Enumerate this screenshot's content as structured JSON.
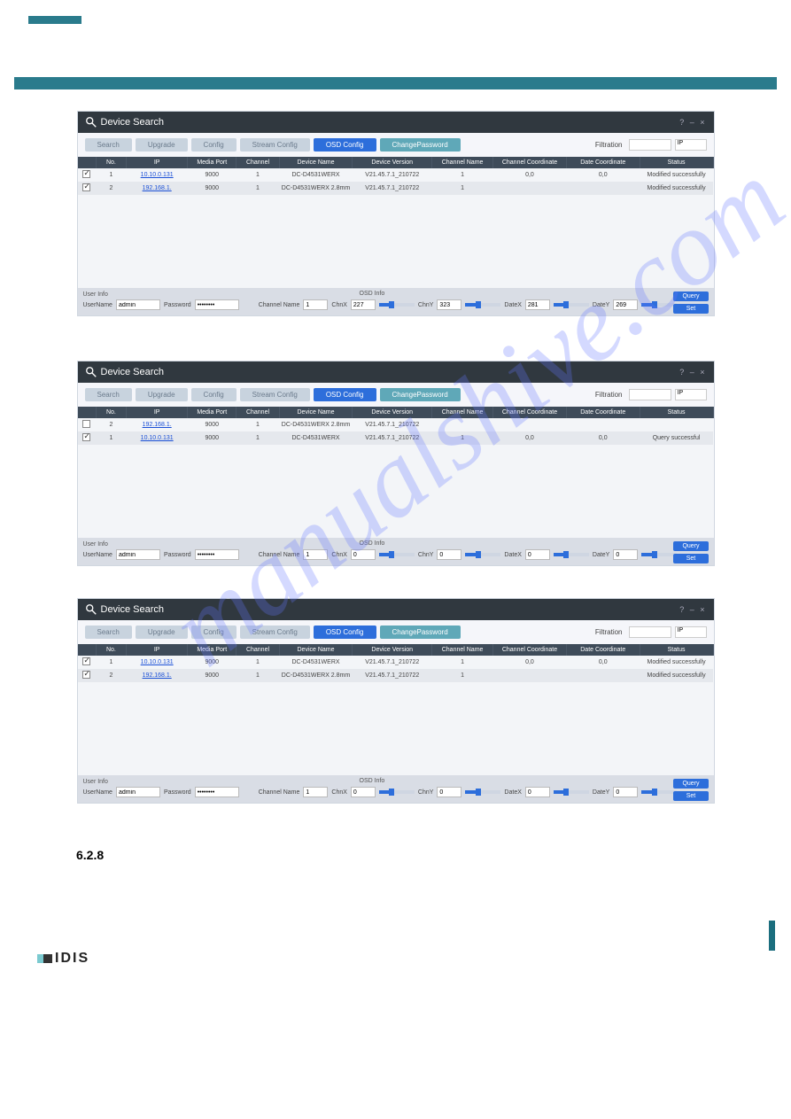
{
  "header_chip": "",
  "app": {
    "title": "Device Search",
    "window_controls": "?  –  ×"
  },
  "toolbar": {
    "search": "Search",
    "upgrade": "Upgrade",
    "config": "Config",
    "stream": "Stream Config",
    "osd": "OSD Config",
    "changepwd": "ChangePassword",
    "filtration_label": "Filtration",
    "filtration_value": "",
    "ip_label": "IP"
  },
  "columns": {
    "cb": "",
    "no": "No.",
    "ip": "IP",
    "port": "Media Port",
    "channel": "Channel",
    "devname": "Device Name",
    "devver": "Device Version",
    "chname": "Channel Name",
    "chcoord": "Channel Coordinate",
    "datecoord": "Date Coordinate",
    "status": "Status"
  },
  "panel1_rows": [
    {
      "ck": true,
      "no": "1",
      "ip": "10.10.0.131",
      "port": "9000",
      "ch": "1",
      "name": "DC-D4531WERX",
      "ver": "V21.45.7.1_210722",
      "cname": "1",
      "ccoord": "0,0",
      "dcoord": "0,0",
      "status": "Modified successfully"
    },
    {
      "ck": true,
      "no": "2",
      "ip": "192.168.1.",
      "port": "9000",
      "ch": "1",
      "name": "DC-D4531WERX 2.8mm",
      "ver": "V21.45.7.1_210722",
      "cname": "1",
      "ccoord": "",
      "dcoord": "",
      "status": "Modified successfully"
    }
  ],
  "panel2_rows": [
    {
      "ck": false,
      "no": "2",
      "ip": "192.168.1.",
      "port": "9000",
      "ch": "1",
      "name": "DC-D4531WERX 2.8mm",
      "ver": "V21.45.7.1_210722",
      "cname": "",
      "ccoord": "",
      "dcoord": "",
      "status": ""
    },
    {
      "ck": true,
      "no": "1",
      "ip": "10.10.0.131",
      "port": "9000",
      "ch": "1",
      "name": "DC-D4531WERX",
      "ver": "V21.45.7.1_210722",
      "cname": "1",
      "ccoord": "0,0",
      "dcoord": "0,0",
      "status": "Query successful"
    }
  ],
  "panel3_rows": [
    {
      "ck": true,
      "no": "1",
      "ip": "10.10.0.131",
      "port": "9000",
      "ch": "1",
      "name": "DC-D4531WERX",
      "ver": "V21.45.7.1_210722",
      "cname": "1",
      "ccoord": "0,0",
      "dcoord": "0,0",
      "status": "Modified successfully"
    },
    {
      "ck": true,
      "no": "2",
      "ip": "192.168.1.",
      "port": "9000",
      "ch": "1",
      "name": "DC-D4531WERX 2.8mm",
      "ver": "V21.45.7.1_210722",
      "cname": "1",
      "ccoord": "",
      "dcoord": "",
      "status": "Modified successfully"
    }
  ],
  "user": {
    "section": "User Info",
    "uname_label": "UserName",
    "uname_value": "admin",
    "pwd_label": "Password",
    "pwd_value": "••••••••"
  },
  "osd1": {
    "section": "OSD Info",
    "chname_label": "Channel Name",
    "chname_value": "1",
    "chx_label": "ChnX",
    "chx_value": "227",
    "chy_label": "ChnY",
    "chy_value": "323",
    "dx_label": "DateX",
    "dx_value": "281",
    "dy_label": "DateY",
    "dy_value": "269"
  },
  "osd2": {
    "section": "OSD Info",
    "chname_label": "Channel Name",
    "chname_value": "1",
    "chx_label": "ChnX",
    "chx_value": "0",
    "chy_label": "ChnY",
    "chy_value": "0",
    "dx_label": "DateX",
    "dx_value": "0",
    "dy_label": "DateY",
    "dy_value": "0"
  },
  "osd3": {
    "section": "OSD Info",
    "chname_label": "Channel Name",
    "chname_value": "1",
    "chx_label": "ChnX",
    "chx_value": "0",
    "chy_label": "ChnY",
    "chy_value": "0",
    "dx_label": "DateX",
    "dx_value": "0",
    "dy_label": "DateY",
    "dy_value": "0"
  },
  "actions": {
    "query": "Query",
    "set": "Set"
  },
  "section_number": "6.2.8",
  "logo_text": "IDIS",
  "watermark": "manualshive.com"
}
